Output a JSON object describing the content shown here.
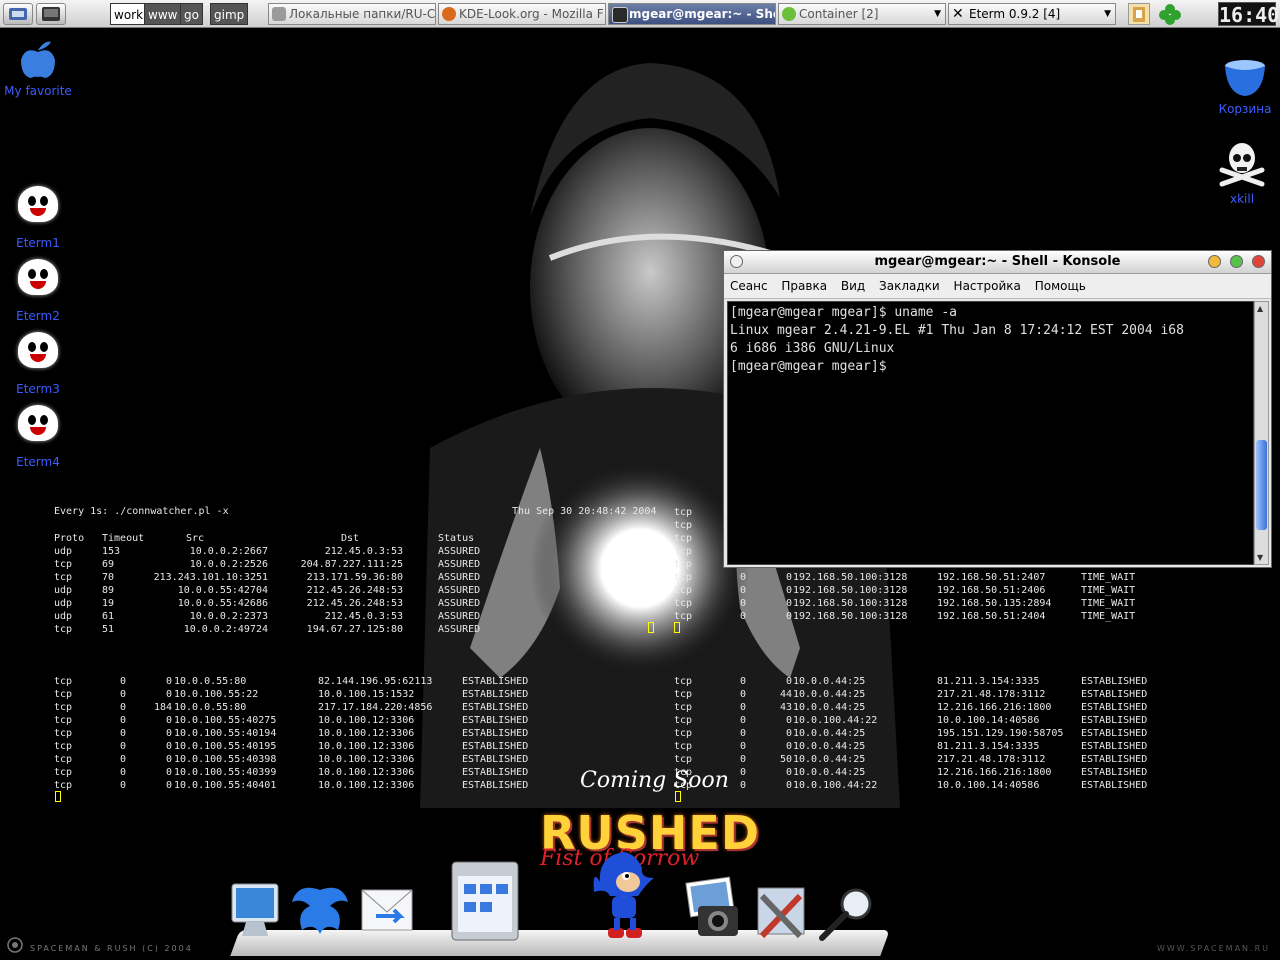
{
  "panel": {
    "desktops": [
      {
        "label": "work",
        "active": true
      },
      {
        "label": "www",
        "active": false
      },
      {
        "label": "go",
        "active": false
      },
      {
        "label": "gimp",
        "active": false
      }
    ],
    "tasks": [
      {
        "label": "Локальные папки/RU-C",
        "active": false,
        "icon_color": "#9a9a9a"
      },
      {
        "label": "KDE-Look.org - Mozilla F",
        "active": false,
        "icon_color": "#d86a1e"
      },
      {
        "label": "mgear@mgear:~ - Shell",
        "active": true,
        "icon_color": "#2a2a2a"
      },
      {
        "label": "Container [2]",
        "active": false,
        "icon_color": "#6cbf3a"
      },
      {
        "label": "Eterm 0.9.2 [4]",
        "active": false,
        "icon_color": "#111111"
      }
    ],
    "clock": "16:40"
  },
  "desktop_icons": [
    {
      "label": "My favorite",
      "icon": "apple-icon"
    },
    {
      "label": "Eterm1",
      "icon": "ghost-icon"
    },
    {
      "label": "Eterm2",
      "icon": "ghost-icon"
    },
    {
      "label": "Eterm3",
      "icon": "ghost-icon"
    },
    {
      "label": "Eterm4",
      "icon": "ghost-icon"
    },
    {
      "label": "Корзина",
      "icon": "trash-icon"
    },
    {
      "label": "xkill",
      "icon": "skull-icon"
    }
  ],
  "watch": {
    "header": "Every 1s: ./connwatcher.pl -x",
    "date": "Thu Sep 30 20:48:42 2004",
    "columns": [
      "Proto",
      "Timeout",
      "Src",
      "Dst",
      "Status"
    ],
    "rows": [
      [
        "udp",
        "153",
        "10.0.0.2:2667",
        "212.45.0.3:53",
        "ASSURED"
      ],
      [
        "tcp",
        "69",
        "10.0.0.2:2526",
        "204.87.227.111:25",
        "ASSURED"
      ],
      [
        "tcp",
        "70",
        "213.243.101.10:3251",
        "213.171.59.36:80",
        "ASSURED"
      ],
      [
        "udp",
        "89",
        "10.0.0.55:42704",
        "212.45.26.248:53",
        "ASSURED"
      ],
      [
        "udp",
        "19",
        "10.0.0.55:42686",
        "212.45.26.248:53",
        "ASSURED"
      ],
      [
        "udp",
        "61",
        "10.0.0.2:2373",
        "212.45.0.3:53",
        "ASSURED"
      ],
      [
        "tcp",
        "51",
        "10.0.0.2:49724",
        "194.67.27.125:80",
        "ASSURED"
      ]
    ]
  },
  "netstat_right_top": [
    [
      "tcp",
      "",
      "",
      "",
      "",
      ""
    ],
    [
      "tcp",
      "",
      "",
      "",
      "",
      ""
    ],
    [
      "tcp",
      "",
      "",
      "",
      "",
      ""
    ],
    [
      "tcp",
      "",
      "",
      "",
      "",
      ""
    ],
    [
      "tcp",
      "",
      "",
      "",
      "",
      ""
    ],
    [
      "tcp",
      "0",
      "0",
      "192.168.50.100:3128",
      "192.168.50.51:2407",
      "TIME_WAIT"
    ],
    [
      "tcp",
      "0",
      "0",
      "192.168.50.100:3128",
      "192.168.50.51:2406",
      "TIME_WAIT"
    ],
    [
      "tcp",
      "0",
      "0",
      "192.168.50.100:3128",
      "192.168.50.135:2894",
      "TIME_WAIT"
    ],
    [
      "tcp",
      "0",
      "0",
      "192.168.50.100:3128",
      "192.168.50.51:2404",
      "TIME_WAIT"
    ]
  ],
  "netstat_left": [
    [
      "tcp",
      "0",
      "0",
      "10.0.0.55:80",
      "82.144.196.95:62113",
      "ESTABLISHED"
    ],
    [
      "tcp",
      "0",
      "0",
      "10.0.100.55:22",
      "10.0.100.15:1532",
      "ESTABLISHED"
    ],
    [
      "tcp",
      "0",
      "184",
      "10.0.0.55:80",
      "217.17.184.220:4856",
      "ESTABLISHED"
    ],
    [
      "tcp",
      "0",
      "0",
      "10.0.100.55:40275",
      "10.0.100.12:3306",
      "ESTABLISHED"
    ],
    [
      "tcp",
      "0",
      "0",
      "10.0.100.55:40194",
      "10.0.100.12:3306",
      "ESTABLISHED"
    ],
    [
      "tcp",
      "0",
      "0",
      "10.0.100.55:40195",
      "10.0.100.12:3306",
      "ESTABLISHED"
    ],
    [
      "tcp",
      "0",
      "0",
      "10.0.100.55:40398",
      "10.0.100.12:3306",
      "ESTABLISHED"
    ],
    [
      "tcp",
      "0",
      "0",
      "10.0.100.55:40399",
      "10.0.100.12:3306",
      "ESTABLISHED"
    ],
    [
      "tcp",
      "0",
      "0",
      "10.0.100.55:40401",
      "10.0.100.12:3306",
      "ESTABLISHED"
    ]
  ],
  "netstat_right": [
    [
      "tcp",
      "0",
      "0",
      "10.0.0.44:25",
      "81.211.3.154:3335",
      "ESTABLISHED"
    ],
    [
      "tcp",
      "0",
      "44",
      "10.0.0.44:25",
      "217.21.48.178:3112",
      "ESTABLISHED"
    ],
    [
      "tcp",
      "0",
      "43",
      "10.0.0.44:25",
      "12.216.166.216:1800",
      "ESTABLISHED"
    ],
    [
      "tcp",
      "0",
      "0",
      "10.0.100.44:22",
      "10.0.100.14:40586",
      "ESTABLISHED"
    ],
    [
      "tcp",
      "0",
      "0",
      "10.0.0.44:25",
      "195.151.129.190:58705",
      "ESTABLISHED"
    ],
    [
      "tcp",
      "0",
      "0",
      "10.0.0.44:25",
      "81.211.3.154:3335",
      "ESTABLISHED"
    ],
    [
      "tcp",
      "0",
      "50",
      "10.0.0.44:25",
      "217.21.48.178:3112",
      "ESTABLISHED"
    ],
    [
      "tcp",
      "0",
      "0",
      "10.0.0.44:25",
      "12.216.166.216:1800",
      "ESTABLISHED"
    ],
    [
      "tcp",
      "0",
      "0",
      "10.0.100.44:22",
      "10.0.100.14:40586",
      "ESTABLISHED"
    ]
  ],
  "konsole": {
    "title": "mgear@mgear:~ - Shell - Konsole",
    "menu": [
      "Сеанс",
      "Правка",
      "Вид",
      "Закладки",
      "Настройка",
      "Помощь"
    ],
    "lines": [
      "[mgear@mgear mgear]$ uname -a",
      "Linux mgear 2.4.21-9.EL #1 Thu Jan 8 17:24:12 EST 2004 i68",
      "6 i686 i386 GNU/Linux",
      "[mgear@mgear mgear]$"
    ],
    "scroll_position": 0.85
  },
  "wallpaper": {
    "coming": "Coming Soon",
    "rushed": "RUSHED",
    "subtitle": "Fist of Sorrow",
    "credit_left": "SPACEMAN & RUSH (C) 2004",
    "credit_right": "WWW.SPACEMAN.RU"
  },
  "dock": [
    "monitor-icon",
    "phoenix-icon",
    "mail-icon",
    "finder-icon",
    "sonic-icon",
    "photos-icon",
    "tools-icon",
    "magnifier-icon"
  ],
  "colors": {
    "accent": "#3c5cff",
    "active_task": "#3d5080"
  }
}
